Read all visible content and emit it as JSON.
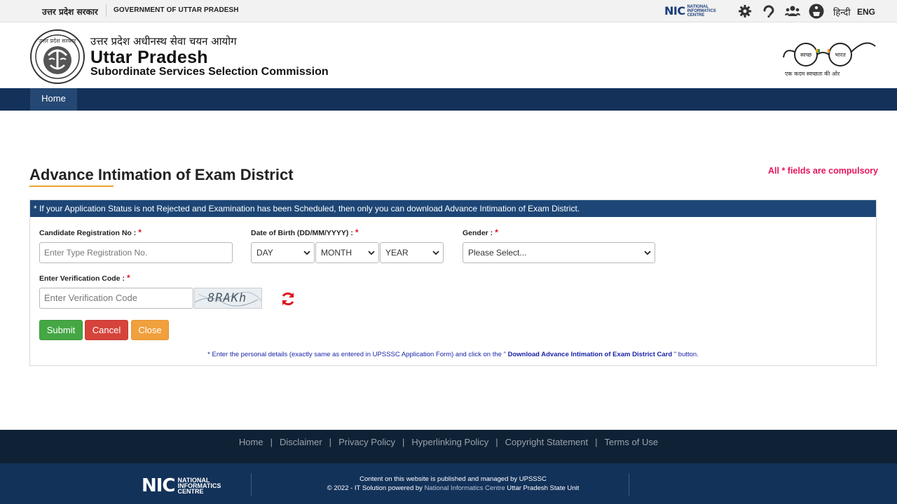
{
  "gov_strip": {
    "hindi_text": "उत्तर प्रदेश सरकार",
    "english_text": "GOVERNMENT OF UTTAR PRADESH",
    "nic_mark": "NIC",
    "nic_words": [
      "NATIONAL",
      "INFORMATICS",
      "CENTRE"
    ],
    "icons": [
      "gear-icon",
      "accessibility-icon",
      "users-icon",
      "sitemap-icon"
    ],
    "lang_hindi": "हिन्दी",
    "lang_english": "ENG"
  },
  "header": {
    "title_hindi": "उत्तर प्रदेश अधीनस्थ सेवा चयन आयोग",
    "title_main": "Uttar Pradesh",
    "title_sub": "Subordinate Services Selection Commission",
    "emblem_text": "उत्तर प्रदेश सरकार",
    "swachh_left": "स्वच्छ",
    "swachh_right": "भारत",
    "swachh_tagline": "एक कदम स्वच्छता की ओर"
  },
  "nav": {
    "home_label": "Home"
  },
  "page": {
    "title": "Advance Intimation of Exam District",
    "compulsory_note": "All * fields are compulsory"
  },
  "form": {
    "info_banner": "* If your Application Status is not Rejected and Examination has been Scheduled, then only you can download Advance Intimation of Exam District.",
    "reg_label": "Candidate Registration No :",
    "reg_placeholder": "Enter Type Registration No.",
    "dob_label": "Date of Birth (DD/MM/YYYY) :",
    "day_value": "DAY",
    "month_value": "MONTH",
    "year_value": "YEAR",
    "gender_label": "Gender :",
    "gender_value": "Please Select...",
    "verify_label": "Enter Verification Code :",
    "verify_placeholder": "Enter Verification Code",
    "captcha_text": "8RAKh",
    "required_mark": "*",
    "submit_label": "Submit",
    "cancel_label": "Cancel",
    "close_label": "Close",
    "note_prefix": "* Enter the personal details (exactly same as entered in UPSSSC Application Form) and click on the \"",
    "note_bold": " Download Advance Intimation of Exam District Card ",
    "note_suffix": "\" button."
  },
  "footer": {
    "links": [
      "Home",
      "Disclaimer",
      "Privacy Policy",
      "Hyperlinking Policy",
      "Copyright Statement",
      "Terms of Use"
    ],
    "separator": "|",
    "nic_mark": "NIC",
    "nic_words": [
      "NATIONAL",
      "INFORMATICS",
      "CENTRE"
    ],
    "line1": "Content on this website is published and managed by UPSSSC",
    "line2_prefix": "© 2022 - IT Solution powered by ",
    "line2_highlight": "National Informatics Centre",
    "line2_suffix": " Uttar Pradesh State Unit"
  },
  "colors": {
    "nav_bg": "#14315a",
    "panel_head_bg": "#1d4676",
    "required": "#e0141e",
    "compulsory": "#e8155a",
    "submit": "#44a744",
    "cancel": "#d6433b",
    "close": "#f0a03c",
    "footer_links_bg": "#0f2135",
    "footer_bottom_bg": "#13325a"
  }
}
